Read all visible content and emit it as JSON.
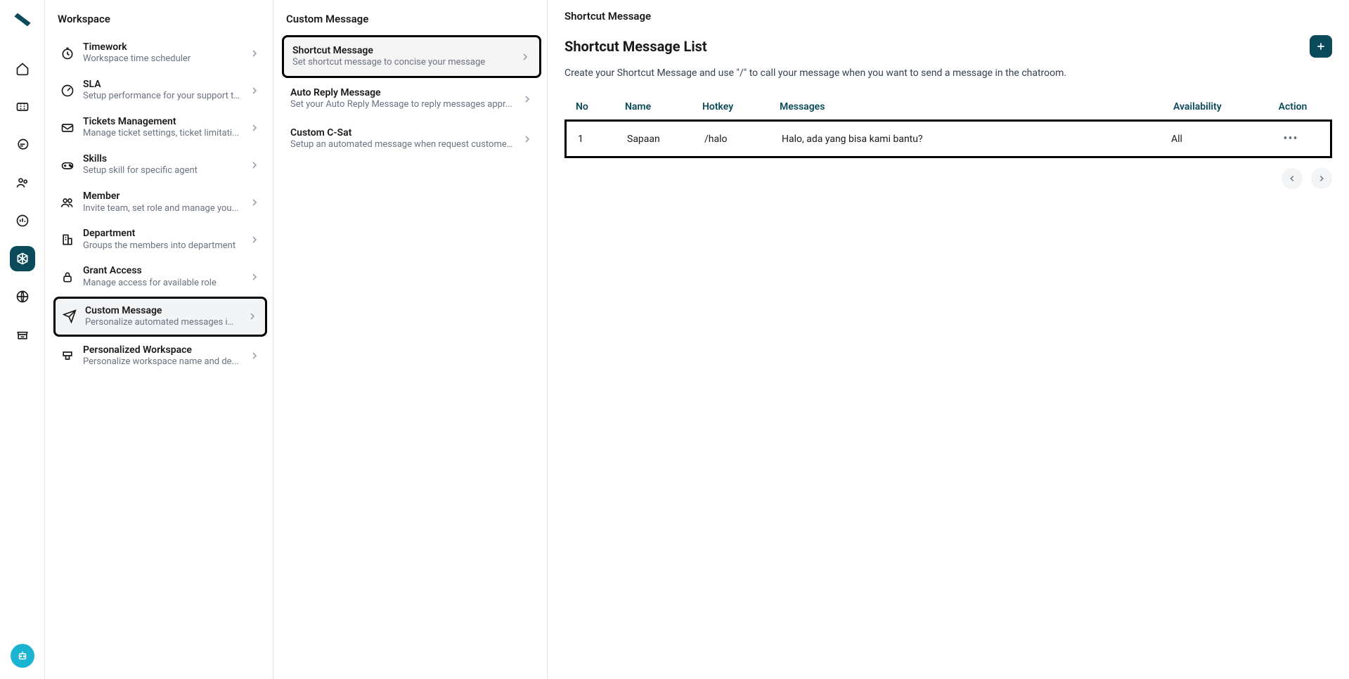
{
  "rail": {
    "items": [
      "home",
      "ticket",
      "chat",
      "users",
      "chart",
      "box",
      "globe",
      "store"
    ],
    "activeIndex": 5
  },
  "workspace": {
    "title": "Workspace",
    "items": [
      {
        "icon": "clock",
        "title": "Timework",
        "sub": "Workspace time scheduler"
      },
      {
        "icon": "gauge",
        "title": "SLA",
        "sub": "Setup performance for your support t..."
      },
      {
        "icon": "mail",
        "title": "Tickets Management",
        "sub": "Manage ticket settings, ticket limitati..."
      },
      {
        "icon": "gamepad",
        "title": "Skills",
        "sub": "Setup skill for specific agent"
      },
      {
        "icon": "people",
        "title": "Member",
        "sub": "Invite team, set role and manage you..."
      },
      {
        "icon": "building",
        "title": "Department",
        "sub": "Groups the members into department"
      },
      {
        "icon": "lock",
        "title": "Grant Access",
        "sub": "Manage access for available role"
      },
      {
        "icon": "send",
        "title": "Custom Message",
        "sub": "Personalize automated messages ins..."
      },
      {
        "icon": "brush",
        "title": "Personalized Workspace",
        "sub": "Personalize workspace name and de..."
      }
    ],
    "selectedIndex": 7
  },
  "customMessage": {
    "title": "Custom Message",
    "items": [
      {
        "title": "Shortcut Message",
        "sub": "Set shortcut message to concise your message"
      },
      {
        "title": "Auto Reply Message",
        "sub": "Set your Auto Reply Message to reply messages appr..."
      },
      {
        "title": "Custom C-Sat",
        "sub": "Setup an automated message when request custome..."
      }
    ],
    "selectedIndex": 0
  },
  "main": {
    "breadcrumb": "Shortcut Message",
    "listTitle": "Shortcut Message List",
    "description": "Create your Shortcut Message and use \"/\" to call your message when you want to send a message in the chatroom.",
    "table": {
      "headers": {
        "no": "No",
        "name": "Name",
        "hotkey": "Hotkey",
        "messages": "Messages",
        "availability": "Availability",
        "action": "Action"
      },
      "rows": [
        {
          "no": "1",
          "name": "Sapaan",
          "hotkey": "/halo",
          "messages": "Halo, ada yang bisa kami bantu?",
          "availability": "All"
        }
      ]
    }
  }
}
